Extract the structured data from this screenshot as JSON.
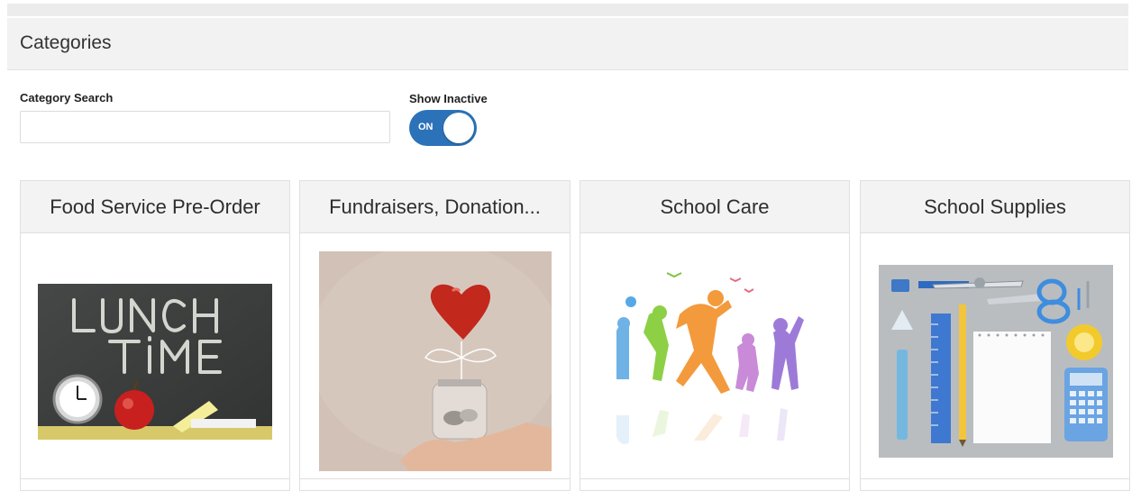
{
  "page": {
    "title": "Categories"
  },
  "filters": {
    "search_label": "Category Search",
    "search_value": "",
    "inactive_label": "Show Inactive",
    "toggle_state": "ON"
  },
  "categories": [
    {
      "title": "Food Service Pre-Order",
      "image": "lunch-time-chalkboard"
    },
    {
      "title": "Fundraisers, Donation...",
      "image": "heart-coin-jar"
    },
    {
      "title": "School Care",
      "image": "jumping-children"
    },
    {
      "title": "School Supplies",
      "image": "school-supplies-flatlay"
    }
  ],
  "colors": {
    "toggle_on": "#2c72b9",
    "header_bg": "#f2f2f2",
    "card_title_bg": "#f3f3f3"
  }
}
